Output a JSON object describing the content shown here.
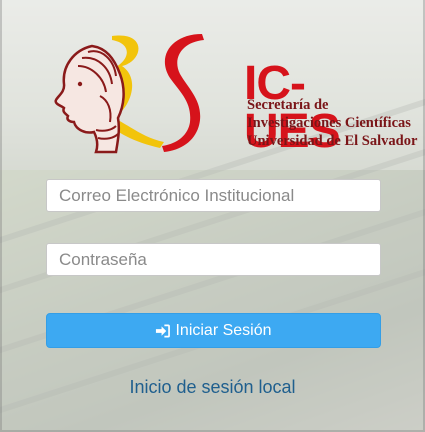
{
  "logo": {
    "brand": "IC-UES",
    "subtitle_lines": [
      "Secretaría de",
      "Investigaciones Científicas",
      "Universidad de El Salvador"
    ]
  },
  "form": {
    "email_placeholder": "Correo Electrónico Institucional",
    "password_placeholder": "Contraseña",
    "submit_label": "Iniciar Sesión",
    "submit_icon": "sign-in-icon"
  },
  "links": {
    "local_login": "Inicio de sesión local"
  },
  "colors": {
    "brand_red": "#d6131b",
    "brand_dark_red": "#7a1518",
    "brand_yellow": "#f2c200",
    "button_blue": "#3da9f2",
    "link_blue": "#1f5f8e"
  }
}
